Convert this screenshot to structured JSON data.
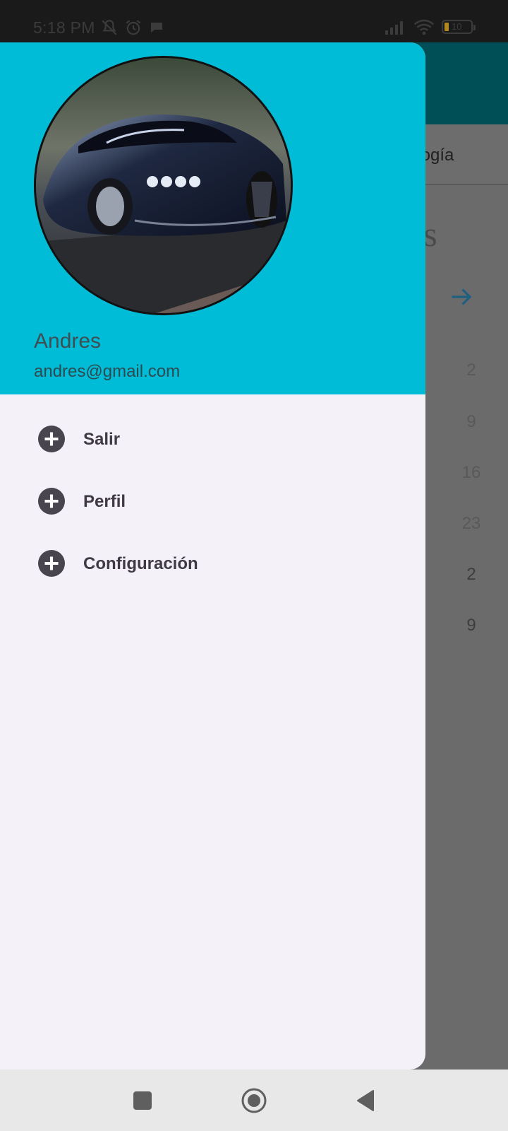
{
  "status_bar": {
    "time": "5:18 PM",
    "battery_level": "10",
    "left_icons": [
      "bell-off-icon",
      "alarm-icon",
      "chat-bubble-icon"
    ],
    "right_icons": [
      "signal-icon",
      "wifi-icon",
      "battery-icon"
    ]
  },
  "background": {
    "tab_label": "ología",
    "heading_fragment": "as",
    "numbers": [
      "2",
      "9",
      "16",
      "23",
      "2",
      "9"
    ]
  },
  "drawer": {
    "header_color": "#00bcd6",
    "user_name": "Andres",
    "user_email": "andres@gmail.com",
    "menu_items": [
      {
        "label": "Salir",
        "icon": "add-circle-icon"
      },
      {
        "label": "Perfil",
        "icon": "add-circle-icon"
      },
      {
        "label": "Configuración",
        "icon": "add-circle-icon"
      }
    ]
  },
  "nav_bar": {
    "buttons": [
      "recents-square-button",
      "home-circle-button",
      "back-triangle-button"
    ]
  }
}
